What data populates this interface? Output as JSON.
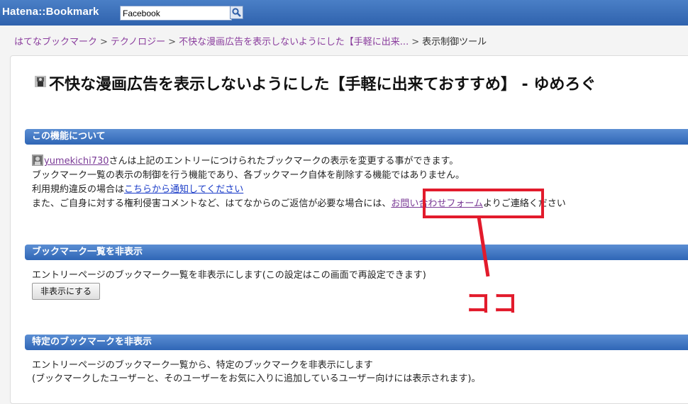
{
  "header": {
    "logo": "Hatena::Bookmark",
    "search": {
      "value": "Facebook",
      "button_icon": "search-icon"
    }
  },
  "breadcrumb": {
    "items": [
      "はてなブックマーク",
      "テクノロジー",
      "不快な漫画広告を表示しないようにした【手軽に出来...",
      "表示制御ツール"
    ],
    "separator": ">"
  },
  "entry": {
    "title": "不快な漫画広告を表示しないようにした【手軽に出来ておすすめ】 - ゆめろぐ",
    "favicon": "site-favicon"
  },
  "about": {
    "heading": "この機能について",
    "user": "yumekichi730",
    "line1_suffix": "さんは上記のエントリーにつけられたブックマークの表示を変更する事ができます。",
    "line2": "ブックマーク一覧の表示の制御を行う機能であり、各ブックマーク自体を削除する機能ではありません。",
    "line3_prefix": "利用規約違反の場合は",
    "line3_link": "こちらから通知してください",
    "line4_prefix": "また、ご自身に対する権利侵害コメントなど、はてなからのご返信が必要な場合には、",
    "line4_link": "お問い合わせフォーム",
    "line4_suffix": "よりご連絡ください"
  },
  "hide_all": {
    "heading": "ブックマーク一覧を非表示",
    "description": "エントリーページのブックマーク一覧を非表示にします(この設定はこの画面で再設定できます)",
    "button": "非表示にする"
  },
  "hide_specific": {
    "heading": "特定のブックマークを非表示",
    "line1": "エントリーページのブックマーク一覧から、特定のブックマークを非表示にします",
    "line2": "(ブックマークしたユーザーと、そのユーザーをお気に入りに追加しているユーザー向けには表示されます)。"
  },
  "annotation": {
    "label": "ココ",
    "color": "#e21b2c"
  },
  "colors": {
    "topbar": "#3a6fb8",
    "section_header": "#3a72bf",
    "link": "#1a3cc8",
    "visited_link": "#8a3d9d"
  }
}
